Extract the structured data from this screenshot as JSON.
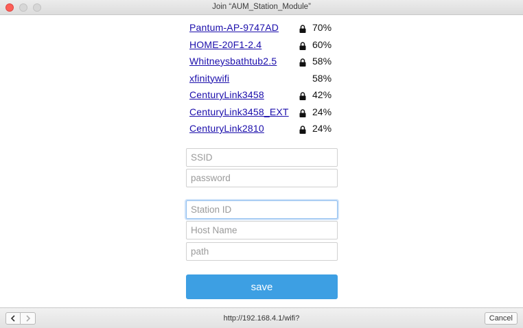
{
  "window": {
    "title": "Join “AUM_Station_Module”"
  },
  "networks": [
    {
      "ssid": "Pantum-AP-9747AD",
      "secured": true,
      "signal": "70%"
    },
    {
      "ssid": "HOME-20F1-2.4",
      "secured": true,
      "signal": "60%"
    },
    {
      "ssid": "Whitneysbathtub2.5",
      "secured": true,
      "signal": "58%"
    },
    {
      "ssid": "xfinitywifi",
      "secured": false,
      "signal": "58%"
    },
    {
      "ssid": "CenturyLink3458",
      "secured": true,
      "signal": "42%"
    },
    {
      "ssid": "CenturyLink3458_EXT",
      "secured": true,
      "signal": "24%"
    },
    {
      "ssid": "CenturyLink2810",
      "secured": true,
      "signal": "24%"
    }
  ],
  "form": {
    "ssid": {
      "placeholder": "SSID",
      "value": ""
    },
    "password": {
      "placeholder": "password",
      "value": ""
    },
    "station_id": {
      "placeholder": "Station ID",
      "value": ""
    },
    "host_name": {
      "placeholder": "Host Name",
      "value": ""
    },
    "path": {
      "placeholder": "path",
      "value": ""
    },
    "save_label": "save"
  },
  "footer": {
    "url": "http://192.168.4.1/wifi?",
    "cancel_label": "Cancel"
  },
  "icons": {
    "lock": "lock-icon",
    "back": "chevron-left-icon",
    "forward": "chevron-right-icon"
  },
  "colors": {
    "link": "#1a0dab",
    "save_button": "#3d9fe3",
    "close_light": "#fc5f57"
  }
}
